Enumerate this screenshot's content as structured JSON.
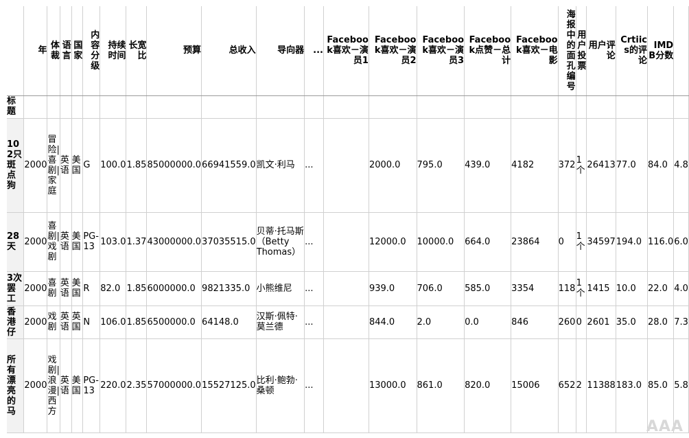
{
  "table": {
    "columns": [
      "年",
      "体裁",
      "语言",
      "国家",
      "内容分级",
      "持续时间",
      "长宽比",
      "预算",
      "总收入",
      "导向器",
      "...",
      "Facebook喜欢－演员1",
      "Facebook喜欢－演员2",
      "Facebook喜欢－演员3",
      "Facebook点赞－总计",
      "Facebook喜欢－电影",
      "海报中的面孔编号",
      "用户投票",
      "用户评论",
      "Crtiics的评论",
      "IMDB分数"
    ],
    "index_name": "标题",
    "rows": [
      {
        "title": "102只斑点狗",
        "cells": [
          "2000",
          "冒险|喜剧|家庭",
          "英语",
          "美国",
          "G",
          "100.0",
          "1.85",
          "85000000.0",
          "66941559.0",
          "凯文·利马",
          "...",
          "2000.0",
          "795.0",
          "439.0",
          "4182",
          "372",
          "1个",
          "26413",
          "77.0",
          "84.0",
          "4.8"
        ]
      },
      {
        "title": "28天",
        "cells": [
          "2000",
          "喜剧|戏剧",
          "英语",
          "美国",
          "PG-13",
          "103.0",
          "1.37",
          "43000000.0",
          "37035515.0",
          "贝蒂·托马斯（Betty Thomas）",
          "...",
          "12000.0",
          "10000.0",
          "664.0",
          "23864",
          "0",
          "1个",
          "34597",
          "194.0",
          "116.0",
          "6.0"
        ]
      },
      {
        "title": "3次罢工",
        "cells": [
          "2000",
          "喜剧",
          "英语",
          "美国",
          "R",
          "82.0",
          "1.85",
          "6000000.0",
          "9821335.0",
          "小熊维尼",
          "...",
          "939.0",
          "706.0",
          "585.0",
          "3354",
          "118",
          "1个",
          "1415",
          "10.0",
          "22.0",
          "4.0"
        ]
      },
      {
        "title": "香港仔",
        "cells": [
          "2000",
          "戏剧",
          "英语",
          "英国",
          "N",
          "106.0",
          "1.85",
          "6500000.0",
          "64148.0",
          "汉斯·佩特·莫兰德",
          "...",
          "844.0",
          "2.0",
          "0.0",
          "846",
          "260",
          "0",
          "2601",
          "35.0",
          "28.0",
          "7.3"
        ]
      },
      {
        "title": "所有漂亮的马",
        "cells": [
          "2000",
          "戏剧|浪漫|西方",
          "英语",
          "美国",
          "PG-13",
          "220.0",
          "2.35",
          "57000000.0",
          "15527125.0",
          "比利·鲍勃·桑顿",
          "...",
          "13000.0",
          "861.0",
          "820.0",
          "15006",
          "652",
          "2",
          "11388",
          "183.0",
          "85.0",
          "5.8"
        ]
      }
    ]
  },
  "watermark": "AAA"
}
